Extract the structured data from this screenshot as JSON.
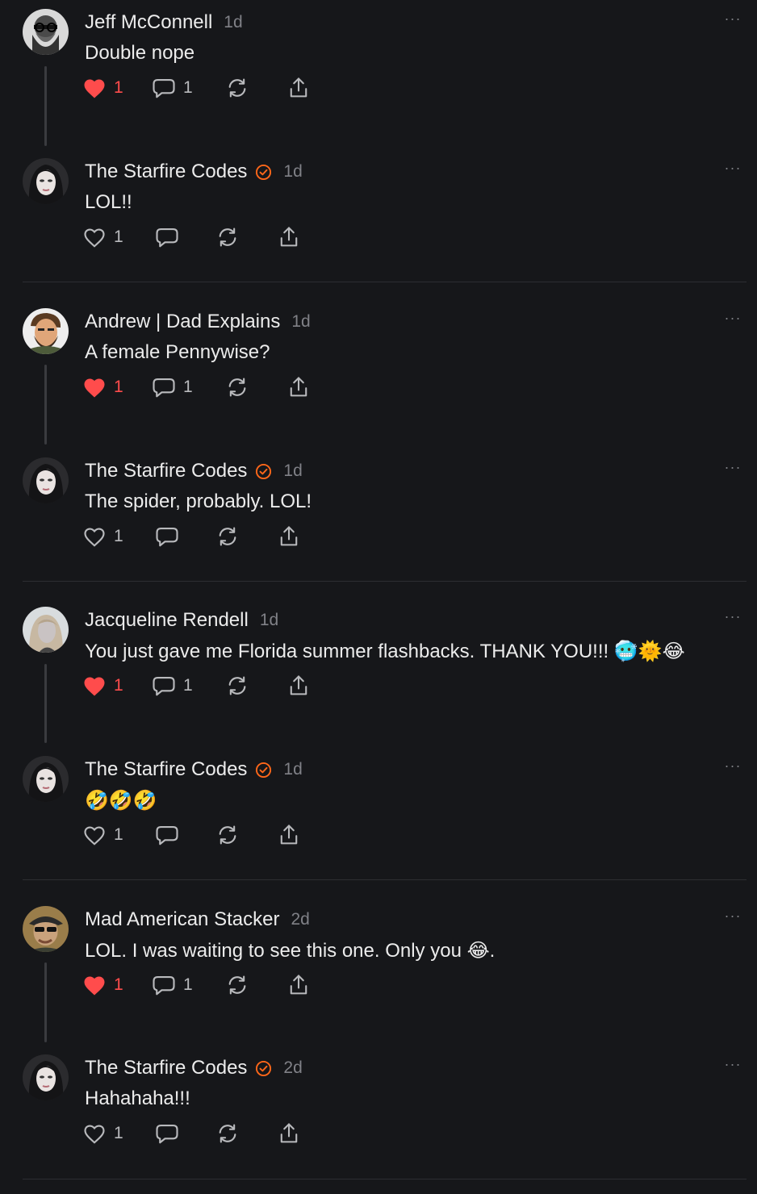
{
  "comments": [
    {
      "author": "Jeff McConnell",
      "verified": false,
      "time": "1d",
      "text": "Double nope",
      "likes": "1",
      "liked": true,
      "replies": "1",
      "avatar": "beard-glasses"
    },
    {
      "author": "The Starfire Codes",
      "verified": true,
      "time": "1d",
      "text": "LOL!!",
      "likes": "1",
      "liked": false,
      "replies": "",
      "avatar": "dark-hair-woman"
    },
    {
      "author": "Andrew | Dad Explains",
      "verified": false,
      "time": "1d",
      "text": "A female Pennywise?",
      "likes": "1",
      "liked": true,
      "replies": "1",
      "avatar": "cartoon-man"
    },
    {
      "author": "The Starfire Codes",
      "verified": true,
      "time": "1d",
      "text": "The spider, probably. LOL!",
      "likes": "1",
      "liked": false,
      "replies": "",
      "avatar": "dark-hair-woman"
    },
    {
      "author": "Jacqueline Rendell",
      "verified": false,
      "time": "1d",
      "text": "You just gave me Florida summer flashbacks. THANK YOU!!! 🥶🌞😂",
      "likes": "1",
      "liked": true,
      "replies": "1",
      "avatar": "blonde-woman"
    },
    {
      "author": "The Starfire Codes",
      "verified": true,
      "time": "1d",
      "text": "🤣🤣🤣",
      "likes": "1",
      "liked": false,
      "replies": "",
      "avatar": "dark-hair-woman"
    },
    {
      "author": "Mad American Stacker",
      "verified": false,
      "time": "2d",
      "text": "LOL. I was waiting to see this one. Only you 😂.",
      "likes": "1",
      "liked": true,
      "replies": "1",
      "avatar": "hat-man"
    },
    {
      "author": "The Starfire Codes",
      "verified": true,
      "time": "2d",
      "text": "Hahahaha!!!",
      "likes": "1",
      "liked": false,
      "replies": "",
      "avatar": "dark-hair-woman"
    }
  ],
  "icons": {
    "like": "heart-icon",
    "reply": "speech-bubble-icon",
    "restack": "restack-icon",
    "share": "share-icon",
    "more": "ellipsis-icon",
    "verified": "verified-check-icon"
  },
  "colors": {
    "background": "#16171a",
    "liked": "#ff4c4c",
    "verified": "#ff6719",
    "muted": "#808187"
  },
  "more_label": "···"
}
